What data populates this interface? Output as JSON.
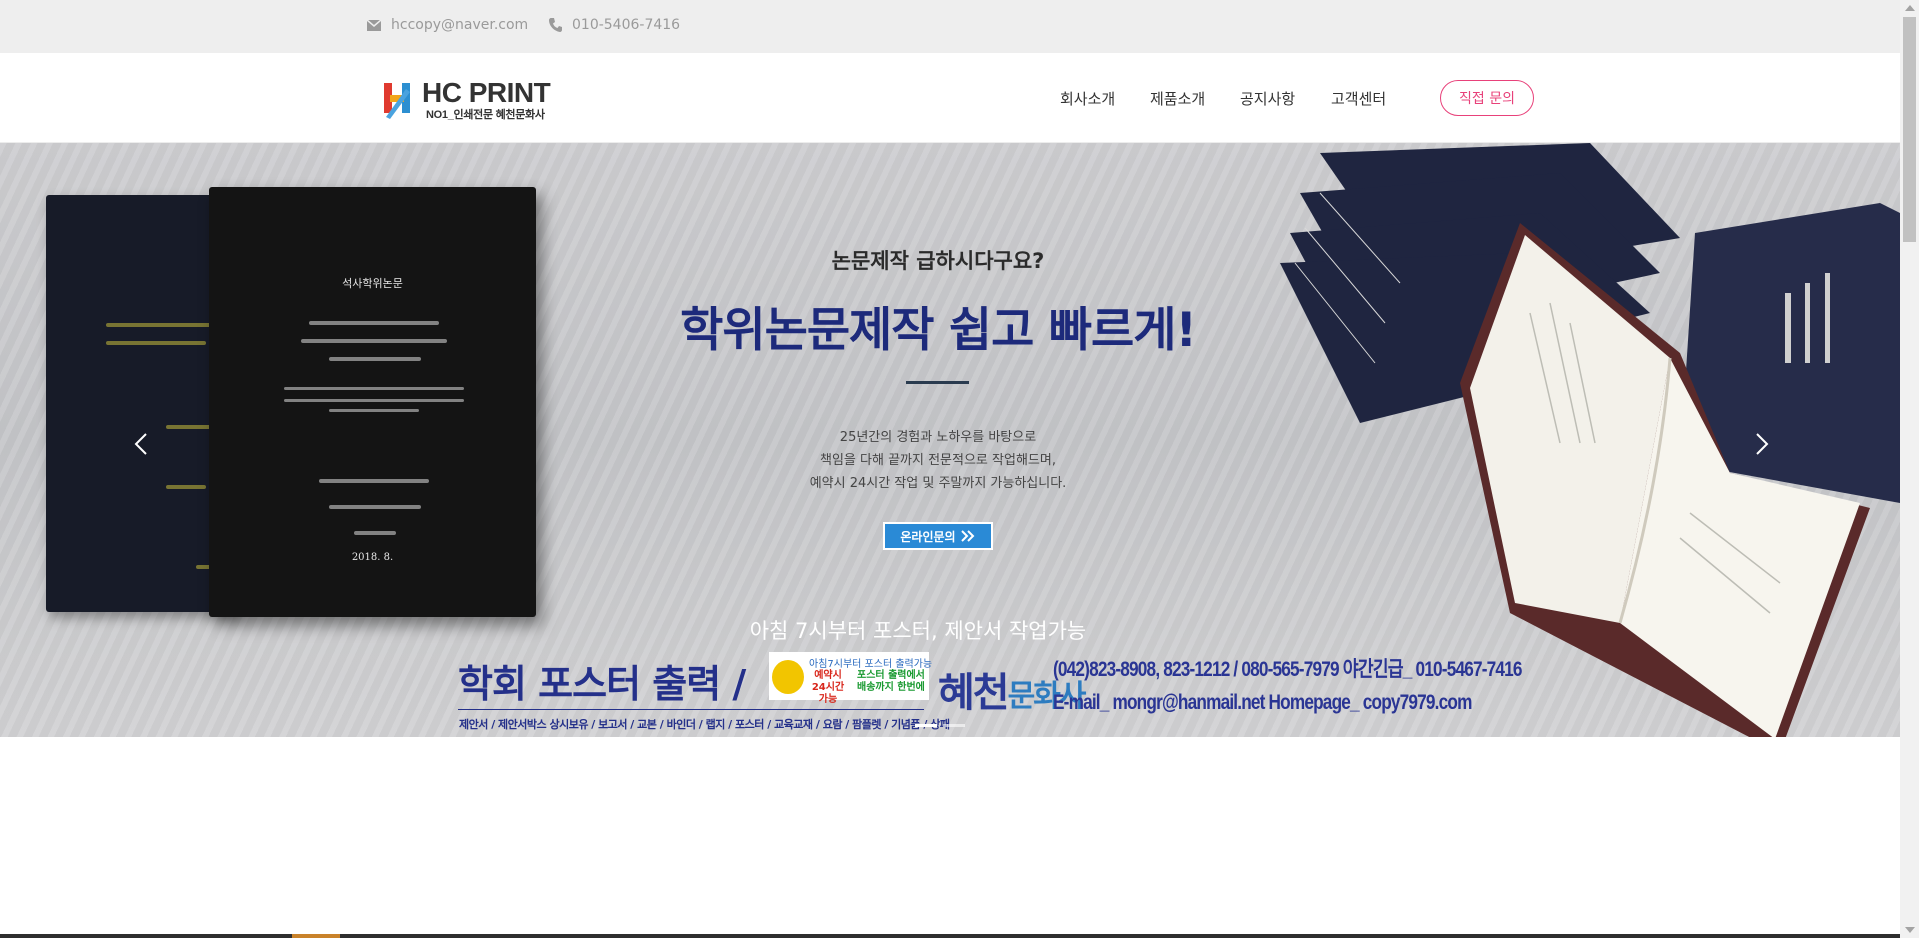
{
  "topbar": {
    "email": "hccopy@naver.com",
    "phone": "010-5406-7416",
    "email_icon": "envelope-icon",
    "phone_icon": "phone-icon"
  },
  "header": {
    "logo_text": "HC PRINT",
    "logo_sub": "NO1_인쇄전문 혜천문화사",
    "nav": [
      "회사소개",
      "제품소개",
      "공지사항",
      "고객센터"
    ],
    "cta_label": "직접 문의",
    "accent": "#e8417a"
  },
  "hero": {
    "subtitle": "논문제작 급하시다구요?",
    "title": "학위논문제작 쉽고 빠르게!",
    "desc_lines": [
      "25년간의 경험과 노하우를 바탕으로",
      "책임을 다해 끝까지 전문적으로 작업해드며,",
      "예약시 24시간 작업 및 주말까지 가능하십니다."
    ],
    "button_label": "온라인문의",
    "book_cover_title": "석사학위논문",
    "book_date": "2018. 8.",
    "prev_icon": "chevron-left-icon",
    "next_icon": "chevron-right-icon",
    "title_color": "#1d2a7b"
  },
  "banner": {
    "headline": "아침 7시부터 포스터, 제안서 작업가능",
    "title": "학회 포스터 출력 /",
    "tags": "제안서 / 제안서박스 상시보유 / 보고서 / 교본 / 바인더 / 랩지 / 포스터 / 교육교재 / 요람 / 팜플렛 / 기념품 / 상패",
    "card_line1": "아침7시부터 포스터 출력가능",
    "card_reserve": "예약시 24시간 가능",
    "card_delivery": "포스터 출력에서 배송까지 한번에",
    "brand_main": "혜천",
    "brand_sub": "문화사",
    "contact_line1": "(042)823-8908, 823-1212 / 080-565-7979   야간긴급_ 010-5467-7416",
    "contact_line2": "E-mail_ mongr@hanmail.net     Homepage_ copy7979.com"
  }
}
